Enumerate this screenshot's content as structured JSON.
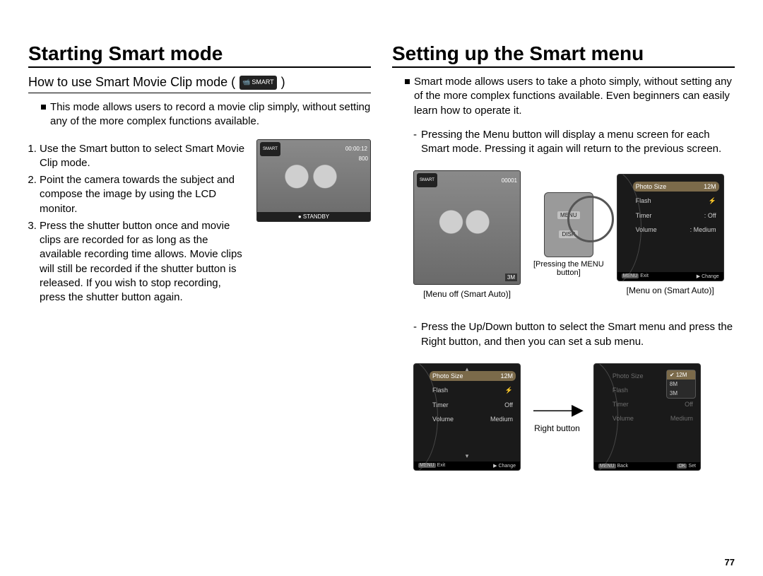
{
  "page_number": "77",
  "left": {
    "title": "Starting Smart mode",
    "subtitle_prefix": "How to use Smart Movie Clip mode ( ",
    "subtitle_suffix": " )",
    "smart_icon_label": "SMART",
    "intro": "This mode allows users to record a movie clip simply, without setting any of the more complex functions available.",
    "steps": [
      "Use the Smart button to select Smart Movie Clip mode.",
      "Point the camera towards the subject and compose the image by using the LCD monitor.",
      "Press the shutter button once and movie clips are recorded for as long as the available recording time allows. Movie clips will still be recorded if the shutter button is released. If you wish to stop recording, press the shutter button again."
    ],
    "lcd": {
      "top_left_icon": "SMART",
      "timer": "00:00:12",
      "res": "800",
      "standby": "● STANDBY"
    }
  },
  "right": {
    "title": "Setting up the Smart menu",
    "intro": "Smart mode allows users to take a photo simply, without setting any of the more complex functions available. Even beginners can easily learn how to operate it.",
    "dash1": "Pressing the Menu button will display a menu screen for each Smart mode. Pressing it again will return to the previous screen.",
    "fig1": {
      "shots_counter": "00001",
      "res_badge": "3M",
      "caption_left": "[Menu off (Smart Auto)]",
      "caption_mid_line1": "[Pressing the MENU",
      "caption_mid_line2": "button]",
      "caption_right": "[Menu on (Smart Auto)]",
      "cam_menu": "MENU",
      "cam_disp": "DISP"
    },
    "menu_rows": [
      {
        "label": "Photo Size",
        "value": "12M"
      },
      {
        "label": "Flash",
        "value": ""
      },
      {
        "label": "Timer",
        "value": "Off"
      },
      {
        "label": "Volume",
        "value": "Medium"
      }
    ],
    "submenu_options": [
      "12M",
      "8M",
      "3M"
    ],
    "foot_exit": "Exit",
    "foot_change": "Change",
    "foot_back": "Back",
    "foot_set": "Set",
    "foot_menu_badge": "MENU",
    "foot_ok_badge": "OK",
    "dash2": "Press the Up/Down button to select the Smart menu and press the Right button, and then you can set a sub menu.",
    "arrow_label": "Right button",
    "flash_icon": "⚡"
  }
}
